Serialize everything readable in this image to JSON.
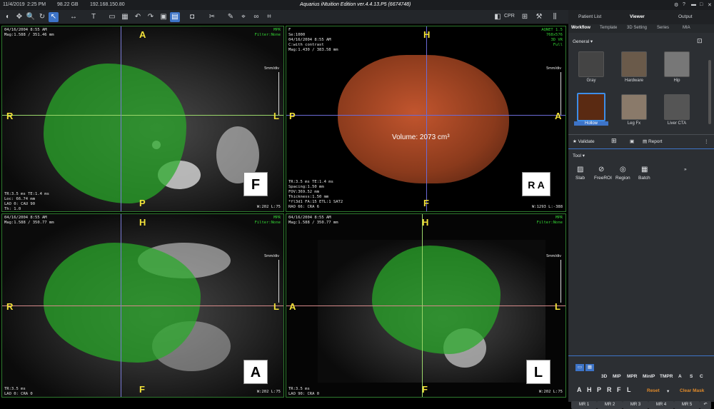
{
  "topbar": {
    "date": "11/4/2019",
    "time": "2:25 PM",
    "disk": "98.22 GB",
    "ip": "192.168.150.80",
    "title": "Aquarius iNtuition Edition ver.4.4.13.P5 (6674748)"
  },
  "toolbar": {
    "cpr": "CPR"
  },
  "panel": {
    "tabs": [
      "Patient List",
      "Viewer",
      "Output"
    ],
    "subtabs": [
      "Workflow",
      "Template",
      "3D Setting",
      "Series",
      "MIA"
    ],
    "general": "General",
    "thumbs": [
      {
        "label": "Gray"
      },
      {
        "label": "Hardware"
      },
      {
        "label": "Hip"
      },
      {
        "label": "Hollow"
      },
      {
        "label": "Leg Fx"
      },
      {
        "label": "Liver CTA"
      }
    ],
    "validate": "Validate",
    "report": "Report",
    "tool": "Tool",
    "tools": [
      {
        "label": "Slab"
      },
      {
        "label": "FreeROI"
      },
      {
        "label": "Region"
      },
      {
        "label": "Batch"
      }
    ],
    "modes": [
      "3D",
      "MIP",
      "MPR",
      "MinIP",
      "TMPR",
      "A",
      "S",
      "C"
    ],
    "letters": [
      "A",
      "H",
      "P",
      "R",
      "F",
      "L"
    ],
    "reset": "Reset",
    "clearmask": "Clear Mask",
    "mr": [
      "MR 1",
      "MR 2",
      "MR 3",
      "MR 4",
      "MR 5"
    ]
  },
  "views": {
    "tl": {
      "info": "04/16/2004 8:55 AM\nMag:1.588 / 351.46 mm",
      "right": "MPR\nFilter:None",
      "bottom": "TR:3.5 ms TE:1.4 ms\nLoc: 66.74 mm\nLAO 0: CAU 90\nTh: 1.0",
      "wl": "W:202 L:75",
      "labels": {
        "top": "A",
        "bottom": "P",
        "left": "R",
        "right": "L"
      },
      "cube": "F",
      "scale": "5mm/div"
    },
    "tr": {
      "info": "F\nSe:1000\n04/16/2004 8:55 AM\nC:with contrast\nMag:1.430 / 383.58 mm",
      "right": "AQNET 1.5\n768x576\n3D VR\nFull",
      "bottom": "TR:3.5 ms TE:1.4 ms\nSpacing:1.50 mm\nFOV:369.52 mm\nThickness:1.50 mm\n*fl3d1 FA:15 ETL:1 SAT2\nRAO 66: CRA 6",
      "wl": "W:1293 L:-388",
      "labels": {
        "top": "H",
        "bottom": "F",
        "left": "P",
        "right": "A"
      },
      "cube": "R A",
      "scale": "5mm/div",
      "volume": "Volume: 2073 cm³"
    },
    "bl": {
      "info": "04/16/2004 8:55 AM\nMag:1.588 / 350.77 mm",
      "right": "MPR\nFilter:None",
      "bottom": "TR:3.5 ms\nLAO 0: CRA 0",
      "wl": "W:202 L:75",
      "labels": {
        "top": "H",
        "bottom": "F",
        "left": "R",
        "right": "L"
      },
      "cube": "A",
      "scale": "5mm/div"
    },
    "br": {
      "info": "04/16/2004 8:55 AM\nMag:1.588 / 350.77 mm",
      "right": "MPR\nFilter:None",
      "bottom": "TR:3.5 ms\nLAO 90: CRA 0",
      "wl": "W:202 L:75",
      "labels": {
        "top": "H",
        "bottom": "F",
        "left": "A",
        "right": "L"
      },
      "cube": "L",
      "scale": "5mm/div"
    }
  }
}
